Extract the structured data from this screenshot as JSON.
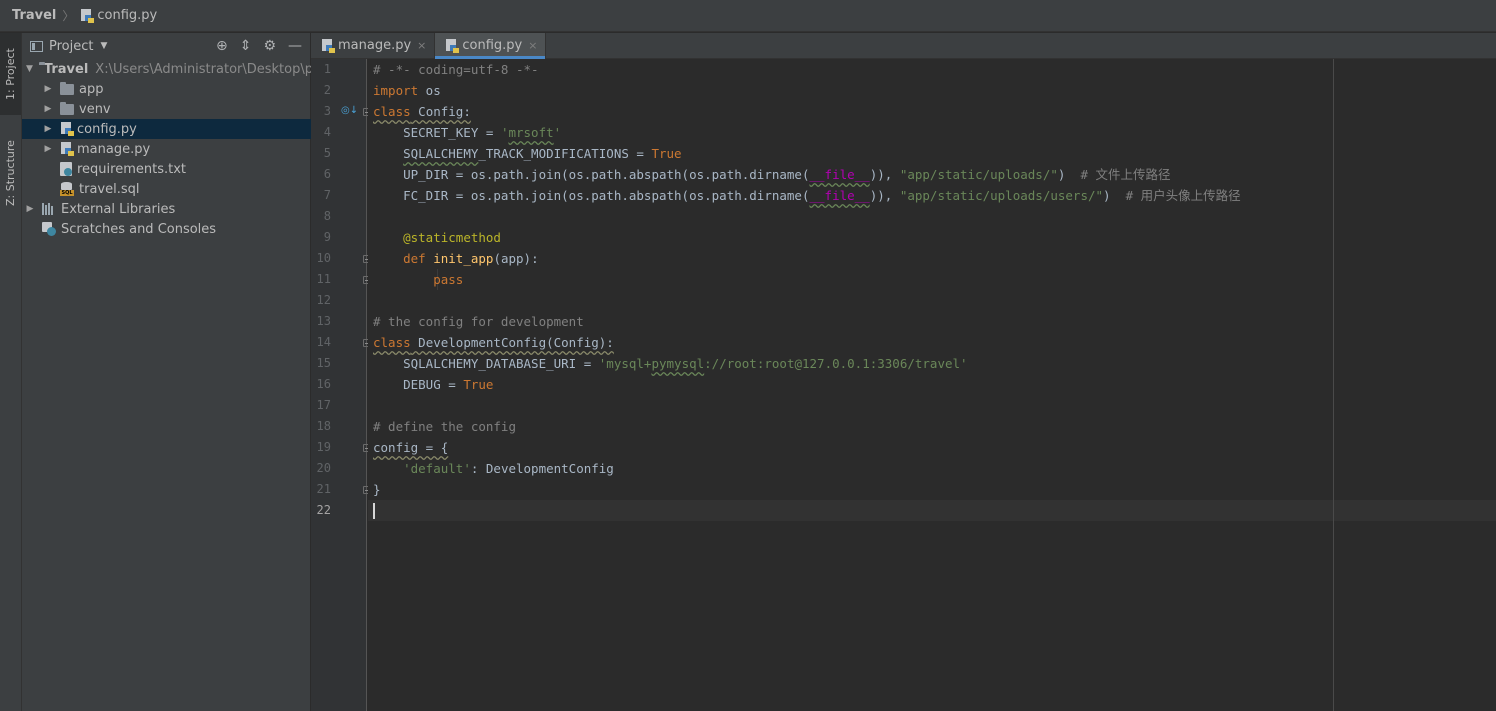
{
  "breadcrumb": {
    "root": "Travel",
    "separator": "〉",
    "file": "config.py"
  },
  "side_tabs": {
    "project": "1: Project",
    "structure": "Z: Structure"
  },
  "project_panel": {
    "title": "Project",
    "tree": [
      {
        "label": "Travel",
        "path": "X:\\Users\\Administrator\\Desktop\\py",
        "type": "root-folder",
        "expanded": true
      },
      {
        "label": "app",
        "type": "folder"
      },
      {
        "label": "venv",
        "type": "folder"
      },
      {
        "label": "config.py",
        "type": "python",
        "selected": true
      },
      {
        "label": "manage.py",
        "type": "python"
      },
      {
        "label": "requirements.txt",
        "type": "text"
      },
      {
        "label": "travel.sql",
        "type": "sql"
      },
      {
        "label": "External Libraries",
        "type": "libraries"
      },
      {
        "label": "Scratches and Consoles",
        "type": "scratches"
      }
    ]
  },
  "editor_tabs": [
    {
      "label": "manage.py",
      "active": false,
      "close": "×"
    },
    {
      "label": "config.py",
      "active": true,
      "close": "×"
    }
  ],
  "editor": {
    "current_line": 22,
    "lines": [
      "# -*- coding=utf-8 -*-",
      "import os",
      "class Config:",
      "    SECRET_KEY = 'mrsoft'",
      "    SQLALCHEMY_TRACK_MODIFICATIONS = True",
      "    UP_DIR = os.path.join(os.path.abspath(os.path.dirname(__file__)), \"app/static/uploads/\")  # 文件上传路径",
      "    FC_DIR = os.path.join(os.path.abspath(os.path.dirname(__file__)), \"app/static/uploads/users/\")  # 用户头像上传路径",
      "",
      "    @staticmethod",
      "    def init_app(app):",
      "        pass",
      "",
      "# the config for development",
      "class DevelopmentConfig(Config):",
      "    SQLALCHEMY_DATABASE_URI = 'mysql+pymysql://root:root@127.0.0.1:3306/travel'",
      "    DEBUG = True",
      "",
      "# define the config",
      "config = {",
      "    'default': DevelopmentConfig",
      "}",
      ""
    ]
  },
  "colors": {
    "keyword": "#cc7832",
    "comment": "#808080",
    "string": "#6a8759",
    "function": "#ffc66d",
    "decorator": "#bbb529",
    "dunder": "#b200b2",
    "selection": "#0d293e",
    "accent": "#4a88c7"
  }
}
